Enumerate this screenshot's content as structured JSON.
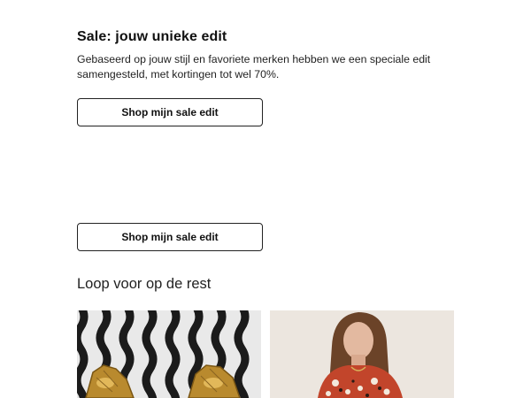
{
  "sale": {
    "title": "Sale: jouw unieke edit",
    "description": "Gebaseerd op jouw stijl en favoriete merken hebben we een speciale edit samengesteld, met kortingen tot wel 70%.",
    "cta_primary": "Shop mijn sale edit",
    "cta_secondary": "Shop mijn sale edit"
  },
  "rest": {
    "title": "Loop voor op de rest"
  },
  "products": [
    {
      "image": "earrings-photo"
    },
    {
      "image": "model-photo"
    }
  ],
  "colors": {
    "text": "#111111",
    "border": "#222222",
    "background": "#ffffff"
  }
}
